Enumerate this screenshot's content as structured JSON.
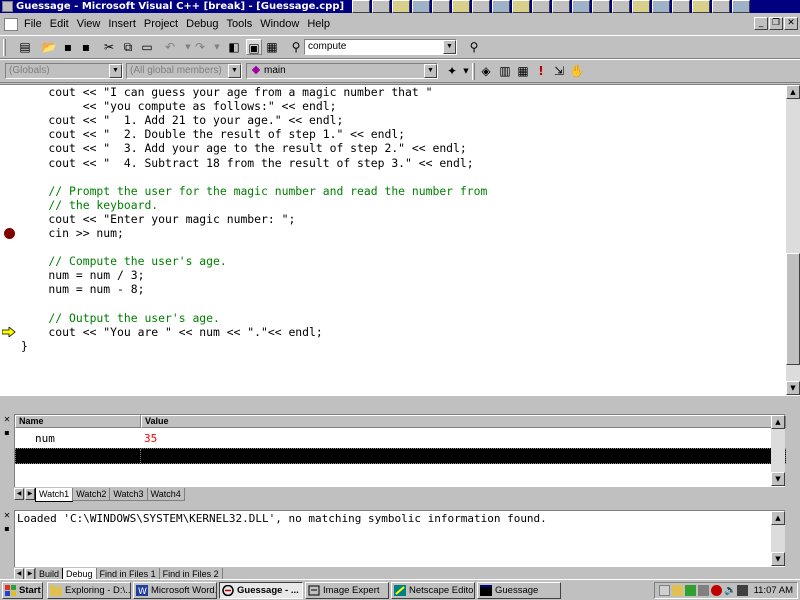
{
  "window": {
    "title": "Guessage - Microsoft Visual C++ [break] - [Guessage.cpp]"
  },
  "menu": {
    "items": [
      "File",
      "Edit",
      "View",
      "Insert",
      "Project",
      "Debug",
      "Tools",
      "Window",
      "Help"
    ]
  },
  "toolbar": {
    "find_combo_value": "compute",
    "scope_combo": "(Globals)",
    "members_combo": "(All global members)",
    "function_combo": "main"
  },
  "editor": {
    "lines": [
      {
        "text": "    cout << \"I can guess your age from a magic number that \"",
        "kind": "code"
      },
      {
        "text": "         << \"you compute as follows:\" << endl;",
        "kind": "code"
      },
      {
        "text": "    cout << \"  1. Add 21 to your age.\" << endl;",
        "kind": "code"
      },
      {
        "text": "    cout << \"  2. Double the result of step 1.\" << endl;",
        "kind": "code"
      },
      {
        "text": "    cout << \"  3. Add your age to the result of step 2.\" << endl;",
        "kind": "code"
      },
      {
        "text": "    cout << \"  4. Subtract 18 from the result of step 3.\" << endl;",
        "kind": "code"
      },
      {
        "text": "",
        "kind": "code"
      },
      {
        "text": "    // Prompt the user for the magic number and read the number from",
        "kind": "comment"
      },
      {
        "text": "    // the keyboard.",
        "kind": "comment"
      },
      {
        "text": "    cout << \"Enter your magic number: \";",
        "kind": "code"
      },
      {
        "text": "    cin >> num;",
        "kind": "code",
        "breakpoint": true
      },
      {
        "text": "",
        "kind": "code"
      },
      {
        "text": "    // Compute the user's age.",
        "kind": "comment"
      },
      {
        "text": "    num = num / 3;",
        "kind": "code"
      },
      {
        "text": "    num = num - 8;",
        "kind": "code"
      },
      {
        "text": "",
        "kind": "code"
      },
      {
        "text": "    // Output the user's age.",
        "kind": "comment"
      },
      {
        "text": "    cout << \"You are \" << num << \".\"<< endl;",
        "kind": "code",
        "current": true
      },
      {
        "text": "}",
        "kind": "code"
      }
    ]
  },
  "watch": {
    "headers": {
      "name": "Name",
      "value": "Value"
    },
    "rows": [
      {
        "name": "num",
        "value": "35"
      }
    ],
    "tabs": [
      "Watch1",
      "Watch2",
      "Watch3",
      "Watch4"
    ],
    "active_tab": "Watch1"
  },
  "output": {
    "text": "Loaded 'C:\\WINDOWS\\SYSTEM\\KERNEL32.DLL', no matching symbolic information found.",
    "tabs": [
      "Build",
      "Debug",
      "Find in Files 1",
      "Find in Files 2"
    ],
    "active_tab": "Debug"
  },
  "taskbar": {
    "start_label": "Start",
    "tasks": [
      {
        "label": "Exploring - D:\\..."
      },
      {
        "label": "Microsoft Word..."
      },
      {
        "label": "Guessage - ...",
        "active": true
      },
      {
        "label": "Image Expert"
      },
      {
        "label": "Netscape Edito..."
      },
      {
        "label": "Guessage"
      }
    ],
    "clock": "11:07 AM"
  },
  "colors": {
    "titlebar": "#000080",
    "comment": "#008000",
    "breakpoint": "#800000",
    "exec_arrow": "#ffff00",
    "watch_value_changed": "#ff0000"
  }
}
